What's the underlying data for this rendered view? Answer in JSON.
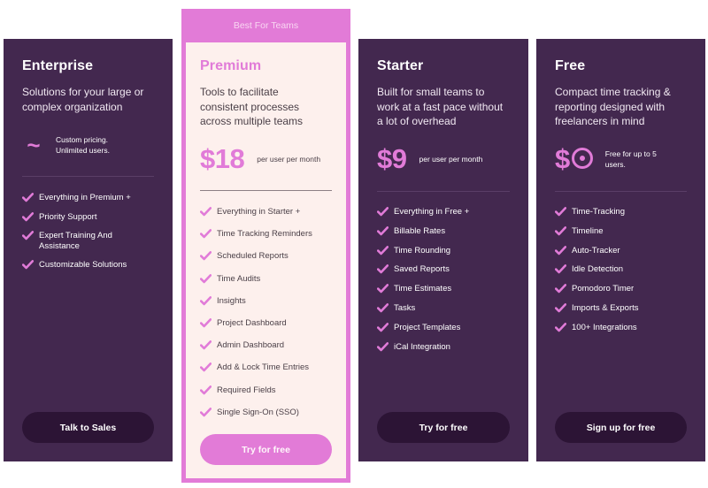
{
  "colors": {
    "card_bg": "#43284f",
    "cta_dark": "#2c1435",
    "accent_pink": "#e17bd8",
    "premium_bg": "#fdf0ed"
  },
  "plans": [
    {
      "name": "Enterprise",
      "description": "Solutions for your large or complex organization",
      "price_symbol": "~",
      "price_note": "Custom pricing. Unlimited users.",
      "features": [
        "Everything in Premium +",
        "Priority Support",
        "Expert Training And Assistance",
        "Customizable Solutions"
      ],
      "cta": "Talk to Sales"
    },
    {
      "ribbon": "Best For Teams",
      "name": "Premium",
      "description": "Tools to facilitate consistent processes across multiple teams",
      "price": "$18",
      "price_note": "per user per month",
      "features": [
        "Everything in Starter +",
        "Time Tracking Reminders",
        "Scheduled Reports",
        "Time Audits",
        "Insights",
        "Project Dashboard",
        "Admin Dashboard",
        "Add & Lock Time Entries",
        "Required Fields",
        "Single Sign-On (SSO)"
      ],
      "cta": "Try for free"
    },
    {
      "name": "Starter",
      "description": "Built for small teams to work at a fast pace without a lot of overhead",
      "price": "$9",
      "price_note": "per user per month",
      "features": [
        "Everything in Free +",
        "Billable Rates",
        "Time Rounding",
        "Saved Reports",
        "Time Estimates",
        "Tasks",
        "Project Templates",
        "iCal Integration"
      ],
      "cta": "Try for free"
    },
    {
      "name": "Free",
      "description": "Compact time tracking & reporting designed with freelancers in mind",
      "price": "$0",
      "price_note": "Free for up to 5 users.",
      "features": [
        "Time-Tracking",
        "Timeline",
        "Auto-Tracker",
        "Idle Detection",
        "Pomodoro Timer",
        "Imports & Exports",
        "100+ Integrations"
      ],
      "cta": "Sign up for free"
    }
  ]
}
